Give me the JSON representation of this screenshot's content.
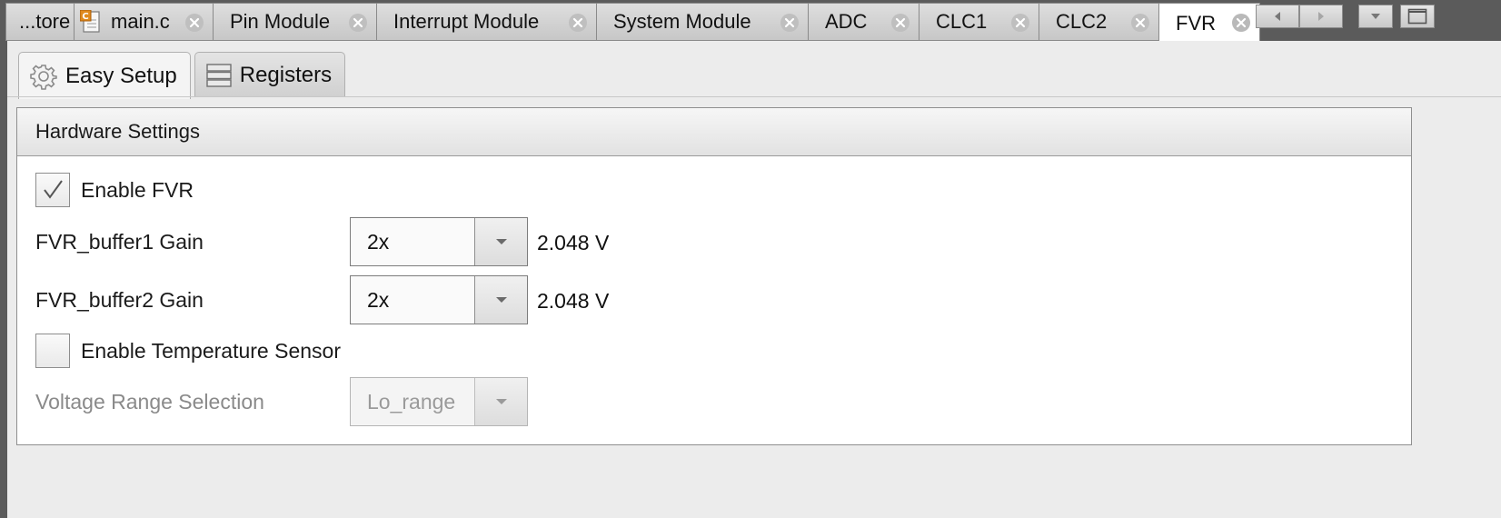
{
  "editor_tabs": [
    {
      "label": "...tore",
      "close": false,
      "active": false,
      "icon": null
    },
    {
      "label": "main.c",
      "close": true,
      "active": false,
      "icon": "c-file-icon"
    },
    {
      "label": "Pin Module",
      "close": true,
      "active": false,
      "icon": null
    },
    {
      "label": "Interrupt Module",
      "close": true,
      "active": false,
      "icon": null
    },
    {
      "label": "System Module",
      "close": true,
      "active": false,
      "icon": null
    },
    {
      "label": "ADC",
      "close": true,
      "active": false,
      "icon": null
    },
    {
      "label": "CLC1",
      "close": true,
      "active": false,
      "icon": null
    },
    {
      "label": "CLC2",
      "close": true,
      "active": false,
      "icon": null
    },
    {
      "label": "FVR",
      "close": true,
      "active": true,
      "icon": null
    }
  ],
  "strip_controls": [
    "scroll-left-icon",
    "scroll-right-icon",
    "tab-menu-icon",
    "maximize-icon"
  ],
  "subtabs": [
    {
      "label": "Easy Setup",
      "icon": "gear-icon",
      "active": true
    },
    {
      "label": "Registers",
      "icon": "registers-icon",
      "active": false
    }
  ],
  "section": {
    "title": "Hardware Settings"
  },
  "settings": {
    "enable_fvr": {
      "label": "Enable FVR",
      "checked": true
    },
    "buffer1": {
      "label": "FVR_buffer1 Gain",
      "value": "2x",
      "voltage": "2.048 V"
    },
    "buffer2": {
      "label": "FVR_buffer2 Gain",
      "value": "2x",
      "voltage": "2.048 V"
    },
    "enable_temp": {
      "label": "Enable Temperature Sensor",
      "checked": false
    },
    "voltage_range": {
      "label": "Voltage Range Selection",
      "value": "Lo_range",
      "enabled": false
    }
  },
  "colors": {
    "background": "#5b5b5b",
    "panel": "#ececec",
    "active_tab": "#ffffff"
  }
}
